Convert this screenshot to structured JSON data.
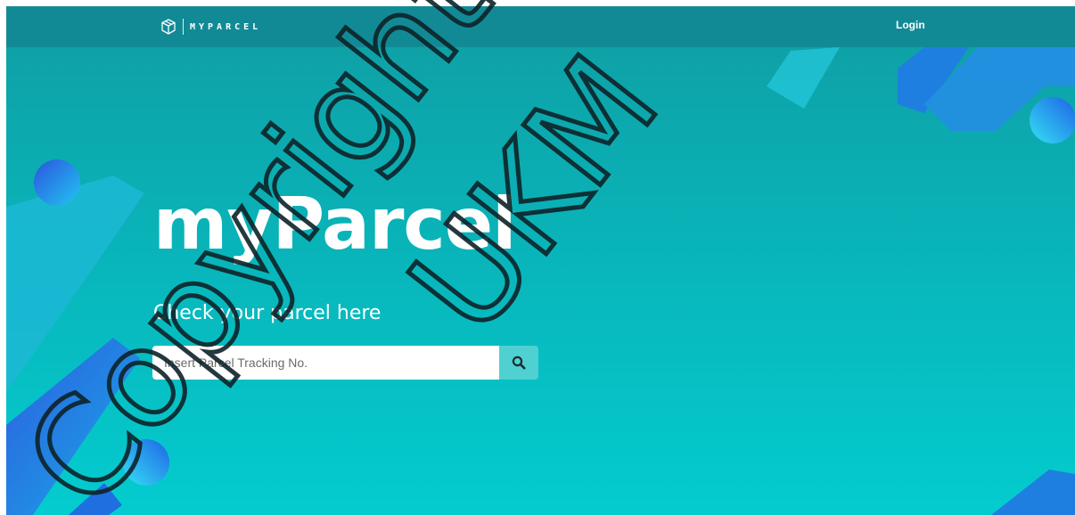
{
  "brand": {
    "name": "MYPARCEL",
    "icon": "package-box-icon"
  },
  "nav": {
    "login_label": "Login"
  },
  "hero": {
    "title": "myParcel",
    "subtitle": "Check your parcel here"
  },
  "search": {
    "placeholder": "Insert Parcel Tracking No.",
    "value": "",
    "button_icon": "search-icon"
  },
  "watermark": {
    "line1": "Copyright",
    "line2": "UKM"
  },
  "colors": {
    "navbar": "#128a96",
    "background_top": "#0f9ea3",
    "background_bottom": "#03cccf",
    "search_button": "#4fd1d1",
    "accent_blue": "#1f7fe0"
  }
}
